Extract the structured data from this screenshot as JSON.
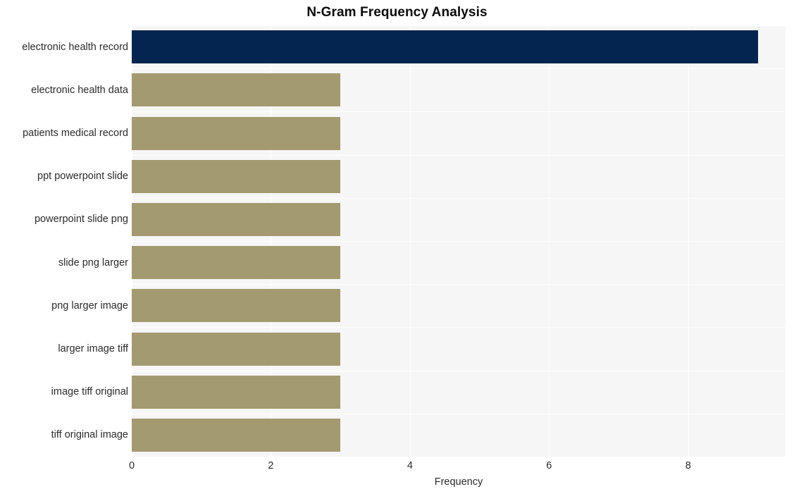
{
  "chart_data": {
    "type": "bar",
    "orientation": "horizontal",
    "title": "N-Gram Frequency Analysis",
    "xlabel": "Frequency",
    "ylabel": "",
    "categories": [
      "electronic health record",
      "electronic health data",
      "patients medical record",
      "ppt powerpoint slide",
      "powerpoint slide png",
      "slide png larger",
      "png larger image",
      "larger image tiff",
      "image tiff original",
      "tiff original image"
    ],
    "values": [
      9,
      3,
      3,
      3,
      3,
      3,
      3,
      3,
      3,
      3
    ],
    "bar_colors": [
      "#04254f",
      "#a49a70",
      "#a49a70",
      "#a49a70",
      "#a49a70",
      "#a49a70",
      "#a49a70",
      "#a49a70",
      "#a49a70",
      "#a49a70"
    ],
    "xlim": [
      0,
      9.4
    ],
    "xticks": [
      0,
      2,
      4,
      6,
      8
    ],
    "xtick_labels": [
      "0",
      "2",
      "4",
      "6",
      "8"
    ],
    "grid": true,
    "grid_color": "#ffffff",
    "plot_background": "#f6f6f7",
    "figure_background": "#ffffff",
    "legend": null,
    "highlight_color": "#04254f",
    "default_color": "#a49a70"
  }
}
